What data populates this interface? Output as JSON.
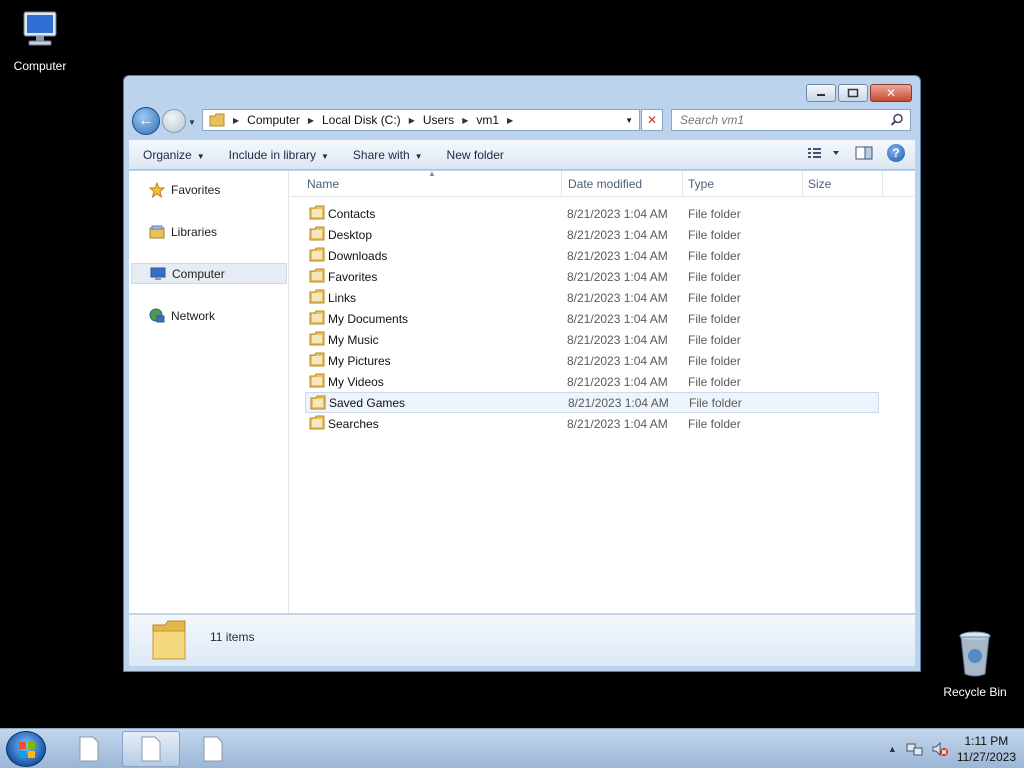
{
  "desktop": {
    "icons": [
      {
        "label": "Computer"
      },
      {
        "label": "Recycle Bin"
      }
    ]
  },
  "window": {
    "breadcrumb": [
      "Computer",
      "Local Disk (C:)",
      "Users",
      "vm1"
    ],
    "search_placeholder": "Search vm1",
    "toolbar": {
      "organize": "Organize",
      "include_in_library": "Include in library",
      "share_with": "Share with",
      "new_folder": "New folder"
    },
    "nav_pane": {
      "items": [
        {
          "label": "Favorites"
        },
        {
          "label": "Libraries"
        },
        {
          "label": "Computer"
        },
        {
          "label": "Network"
        }
      ],
      "selected": "Computer"
    },
    "columns": [
      "Name",
      "Date modified",
      "Type",
      "Size"
    ],
    "files": [
      {
        "name": "Contacts",
        "date": "8/21/2023 1:04 AM",
        "type": "File folder"
      },
      {
        "name": "Desktop",
        "date": "8/21/2023 1:04 AM",
        "type": "File folder"
      },
      {
        "name": "Downloads",
        "date": "8/21/2023 1:04 AM",
        "type": "File folder"
      },
      {
        "name": "Favorites",
        "date": "8/21/2023 1:04 AM",
        "type": "File folder"
      },
      {
        "name": "Links",
        "date": "8/21/2023 1:04 AM",
        "type": "File folder"
      },
      {
        "name": "My Documents",
        "date": "8/21/2023 1:04 AM",
        "type": "File folder"
      },
      {
        "name": "My Music",
        "date": "8/21/2023 1:04 AM",
        "type": "File folder"
      },
      {
        "name": "My Pictures",
        "date": "8/21/2023 1:04 AM",
        "type": "File folder"
      },
      {
        "name": "My Videos",
        "date": "8/21/2023 1:04 AM",
        "type": "File folder"
      },
      {
        "name": "Saved Games",
        "date": "8/21/2023 1:04 AM",
        "type": "File folder"
      },
      {
        "name": "Searches",
        "date": "8/21/2023 1:04 AM",
        "type": "File folder"
      }
    ],
    "hovered_file": "Saved Games",
    "details": {
      "count": "11 items"
    }
  },
  "taskbar": {
    "clock_time": "1:11 PM",
    "clock_date": "11/27/2023"
  },
  "colors": {
    "window_frame": "#bcd3ee",
    "folder_yellow": "#e8c15a",
    "accent_blue": "#2f6fb3"
  }
}
